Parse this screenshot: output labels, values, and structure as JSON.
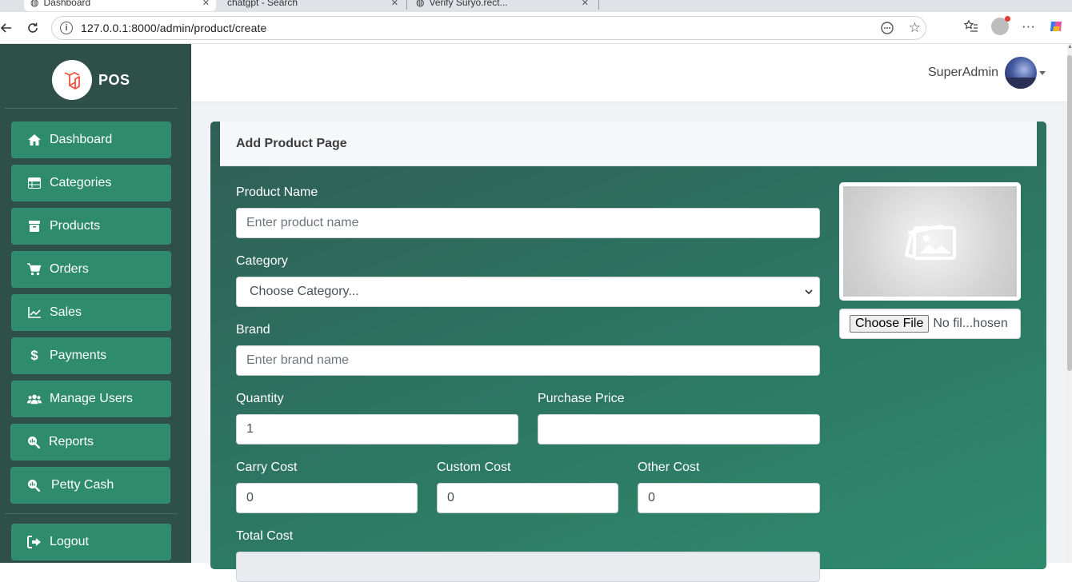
{
  "browser": {
    "tabs": [
      {
        "title": "Dashboard"
      },
      {
        "title": "chatgpt - Search"
      },
      {
        "title": "Verify Suryo.rect..."
      }
    ],
    "url": "127.0.0.1:8000/admin/product/create"
  },
  "sidebar": {
    "brand": "POS",
    "items": [
      {
        "label": "Dashboard",
        "icon": "home-icon"
      },
      {
        "label": "Categories",
        "icon": "table-icon"
      },
      {
        "label": "Products",
        "icon": "box-icon"
      },
      {
        "label": "Orders",
        "icon": "cart-icon"
      },
      {
        "label": "Sales",
        "icon": "chart-line-icon"
      },
      {
        "label": "Payments",
        "icon": "dollar-icon"
      },
      {
        "label": "Manage Users",
        "icon": "users-icon"
      },
      {
        "label": "Reports",
        "icon": "search-chart-icon"
      },
      {
        "label": "Petty Cash",
        "icon": "search-chart-icon"
      }
    ],
    "logout": {
      "label": "Logout",
      "icon": "logout-icon"
    }
  },
  "header": {
    "user_name": "SuperAdmin"
  },
  "form": {
    "title": "Add Product Page",
    "product_name": {
      "label": "Product Name",
      "placeholder": "Enter product name",
      "value": ""
    },
    "category": {
      "label": "Category",
      "selected": "Choose Category..."
    },
    "brand": {
      "label": "Brand",
      "placeholder": "Enter brand name",
      "value": ""
    },
    "quantity": {
      "label": "Quantity",
      "value": "1"
    },
    "purchase_price": {
      "label": "Purchase Price",
      "value": ""
    },
    "carry_cost": {
      "label": "Carry Cost",
      "value": "0"
    },
    "custom_cost": {
      "label": "Custom Cost",
      "value": "0"
    },
    "other_cost": {
      "label": "Other Cost",
      "value": "0"
    },
    "total_cost": {
      "label": "Total Cost",
      "value": ""
    },
    "file": {
      "button": "Choose File",
      "status": "No fil...hosen"
    }
  }
}
